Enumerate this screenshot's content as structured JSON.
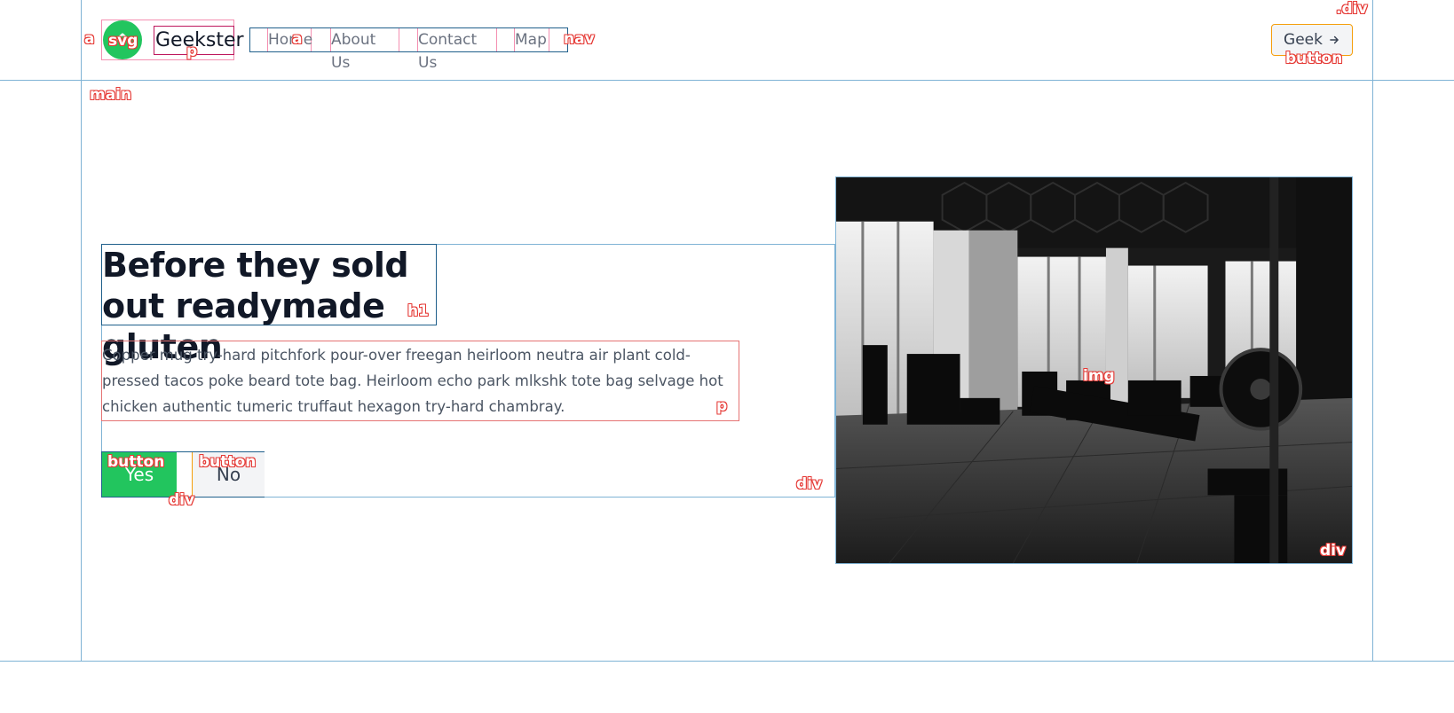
{
  "header": {
    "brand": "Geekster",
    "nav": [
      "Home",
      "About Us",
      "Contact Us",
      "Map"
    ],
    "cta_label": "Geek"
  },
  "hero": {
    "title": "Before they sold out readymade gluten",
    "description": "Copper mug try-hard pitchfork pour-over freegan heirloom neutra air plant cold-pressed tacos poke beard tote bag. Heirloom echo park mlkshk tote bag selvage hot chicken authentic tumeric truffaut hexagon try-hard chambray.",
    "yes_label": "Yes",
    "no_label": "No"
  },
  "overlay_tags": {
    "div_top": ".div",
    "a": "a",
    "svg": "svg",
    "p_brand": "p",
    "a_nav": "a",
    "nav": "nav",
    "button_geek": "button",
    "main": "main",
    "h1": "h1",
    "p_desc": "p",
    "button_yes": "button",
    "button_no": "button",
    "div_btns": "div",
    "div_text": "div",
    "img": "img",
    "div_img": "div"
  },
  "colors": {
    "accent": "#22c55e",
    "outline_blue": "#7fb3d5",
    "tag_red": "#e53935"
  },
  "icons": {
    "logo": "house-roof-icon",
    "cta": "arrow-right-icon"
  }
}
